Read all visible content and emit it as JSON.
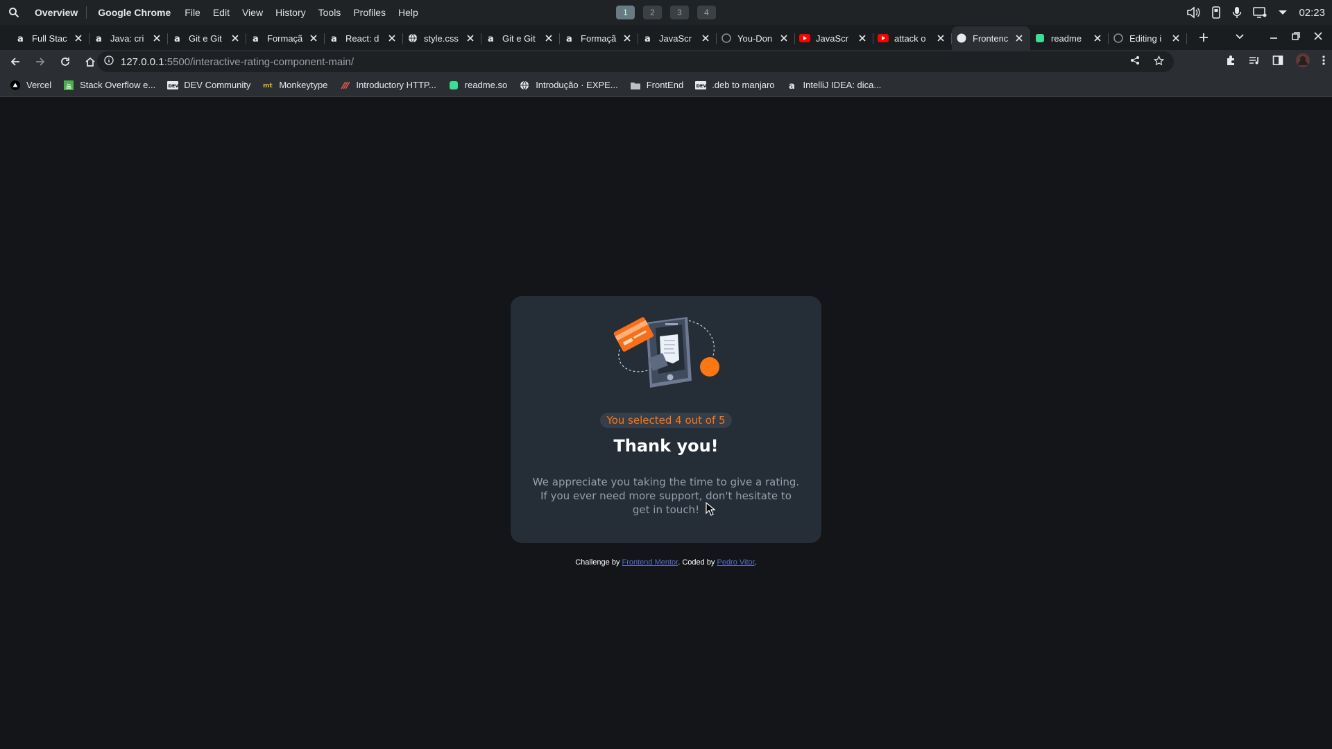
{
  "topbar": {
    "overview": "Overview",
    "app_name": "Google Chrome",
    "menu": [
      "File",
      "Edit",
      "View",
      "History",
      "Tools",
      "Profiles",
      "Help"
    ],
    "workspaces": [
      "1",
      "2",
      "3",
      "4"
    ],
    "active_workspace": "1",
    "clock": "02:23"
  },
  "tabs": [
    {
      "title": "Full Stac",
      "icon": "alura-icon"
    },
    {
      "title": "Java: cri",
      "icon": "alura-icon"
    },
    {
      "title": "Git e Git",
      "icon": "alura-icon"
    },
    {
      "title": "Formaçã",
      "icon": "alura-icon"
    },
    {
      "title": "React: d",
      "icon": "alura-icon"
    },
    {
      "title": "style.css",
      "icon": "globe-icon"
    },
    {
      "title": "Git e Git",
      "icon": "alura-icon"
    },
    {
      "title": "Formaçã",
      "icon": "alura-icon"
    },
    {
      "title": "JavaScr",
      "icon": "alura-icon"
    },
    {
      "title": "You-Don",
      "icon": "github-icon"
    },
    {
      "title": "JavaScr",
      "icon": "youtube-icon"
    },
    {
      "title": "attack o",
      "icon": "youtube-icon"
    },
    {
      "title": "Frontenc",
      "icon": "frontend-icon",
      "active": true
    },
    {
      "title": "readme",
      "icon": "readme-icon"
    },
    {
      "title": "Editing i",
      "icon": "github-icon"
    }
  ],
  "address": {
    "host": "127.0.0.1",
    "path": ":5500/interactive-rating-component-main/"
  },
  "bookmarks": [
    {
      "label": "Vercel",
      "icon": "vercel-icon"
    },
    {
      "label": "Stack Overflow e...",
      "icon": "stackoverflow-icon"
    },
    {
      "label": "DEV Community",
      "icon": "dev-icon"
    },
    {
      "label": "Monkeytype",
      "icon": "monkeytype-icon"
    },
    {
      "label": "Introductory HTTP...",
      "icon": "http-icon"
    },
    {
      "label": "readme.so",
      "icon": "readme-icon"
    },
    {
      "label": "Introdução · EXPE...",
      "icon": "globe-icon"
    },
    {
      "label": "FrontEnd",
      "icon": "folder-icon"
    },
    {
      "label": ".deb to manjaro",
      "icon": "dev-icon"
    },
    {
      "label": "IntelliJ IDEA: dica...",
      "icon": "alura-icon"
    }
  ],
  "card": {
    "badge": "You selected 4 out of 5",
    "title": "Thank you!",
    "message": "We appreciate you taking the time to give a rating. If you ever need more support, don't hesitate to get in touch!"
  },
  "attribution": {
    "prefix": "Challenge by ",
    "link1": "Frontend Mentor",
    "middle": ". Coded by ",
    "link2": "Pedro Vitor",
    "suffix": "."
  },
  "colors": {
    "accent": "#fc7614",
    "card_bg": "#252d37",
    "page_bg": "#131518",
    "link": "#5a6ec8"
  }
}
